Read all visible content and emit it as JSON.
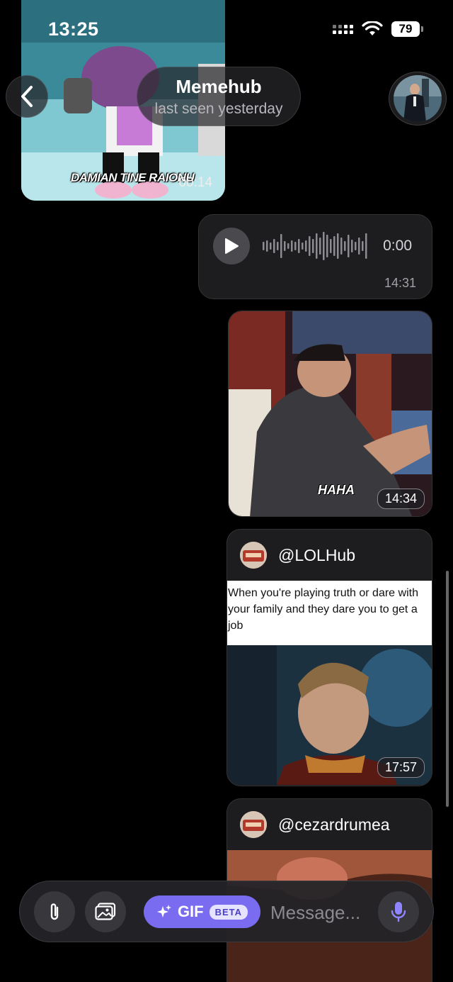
{
  "status_bar": {
    "time": "13:25",
    "battery": "79"
  },
  "header": {
    "title": "Memehub",
    "subtitle": "last seen yesterday"
  },
  "messages": {
    "cartoon_video": {
      "duration": "00:14",
      "caption": "DAMIAN TINE RAIONU"
    },
    "voice": {
      "duration": "0:00",
      "time": "14:31"
    },
    "laugh_gif": {
      "caption": "HAHA",
      "time": "14:34"
    },
    "post1": {
      "handle": "@LOLHub",
      "text": "When you're playing truth or dare with your family and they dare you to get a job",
      "time": "17:57"
    },
    "post2": {
      "handle": "@cezardrumea"
    }
  },
  "composer": {
    "gif_label": "GIF",
    "beta_label": "BETA",
    "placeholder": "Message..."
  },
  "colors": {
    "accent": "#7a6cf0",
    "mic": "#8f86ff",
    "bubble": "#1d1d1f"
  },
  "icons": [
    "chevron-left-icon",
    "wifi-icon",
    "signal-icon",
    "battery-icon",
    "play-icon",
    "paperclip-icon",
    "gallery-icon",
    "sparkle-icon",
    "microphone-icon"
  ]
}
